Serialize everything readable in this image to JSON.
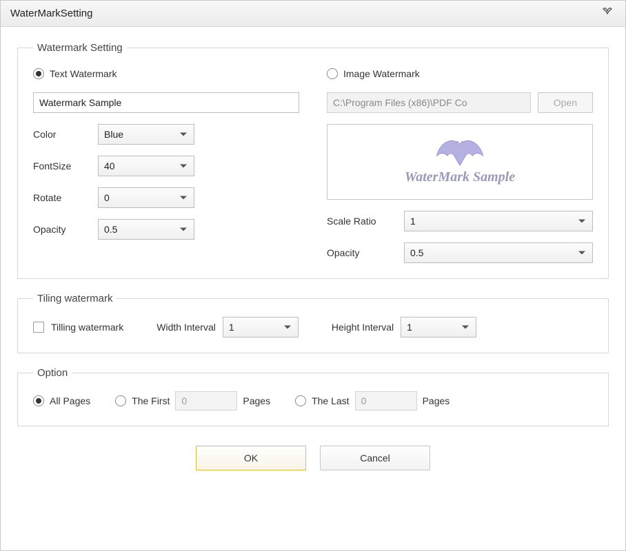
{
  "window": {
    "title": "WaterMarkSetting"
  },
  "watermark": {
    "legend": "Watermark Setting",
    "text_radio_label": "Text Watermark",
    "image_radio_label": "Image Watermark",
    "text_value": "Watermark Sample",
    "image_path": "C:\\Program Files (x86)\\PDF Co",
    "open_button": "Open",
    "color_label": "Color",
    "color_value": "Blue",
    "fontsize_label": "FontSize",
    "fontsize_value": "40",
    "rotate_label": "Rotate",
    "rotate_value": "0",
    "opacity_label": "Opacity",
    "opacity_value": "0.5",
    "preview_text": "WaterMark Sample",
    "scale_label": "Scale Ratio",
    "scale_value": "1",
    "image_opacity_label": "Opacity",
    "image_opacity_value": "0.5"
  },
  "tiling": {
    "legend": "Tiling watermark",
    "checkbox_label": "Tilling watermark",
    "width_label": "Width Interval",
    "width_value": "1",
    "height_label": "Height Interval",
    "height_value": "1"
  },
  "option": {
    "legend": "Option",
    "all_pages": "All Pages",
    "the_first": "The First",
    "the_last": "The Last",
    "pages_suffix": "Pages",
    "first_value": "0",
    "last_value": "0"
  },
  "footer": {
    "ok": "OK",
    "cancel": "Cancel"
  }
}
